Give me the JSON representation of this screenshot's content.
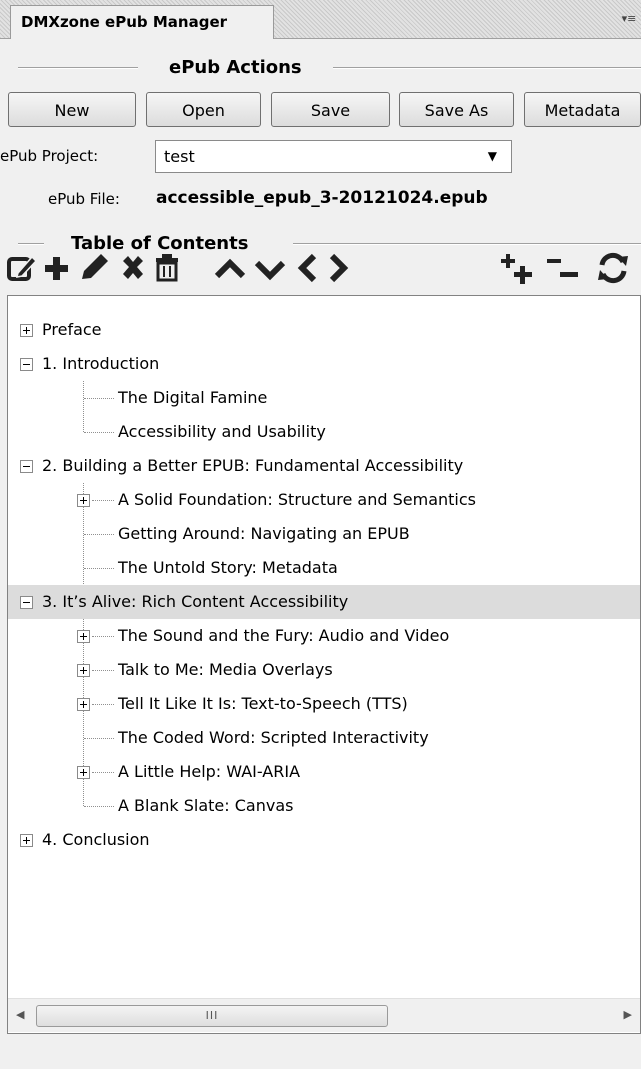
{
  "panel": {
    "tab_title": "DMXzone ePub Manager",
    "menu_icon": "panel-menu-icon"
  },
  "actions": {
    "section_title": "ePub Actions",
    "buttons": [
      "New",
      "Open",
      "Save",
      "Save As",
      "Metadata"
    ]
  },
  "project": {
    "label": "ePub Project:",
    "value": "test",
    "file_label": "ePub File:",
    "file_value": "accessible_epub_3-20121024.epub"
  },
  "toc": {
    "section_title": "Table of Contents",
    "toolbar_icons": [
      "edit-icon",
      "add-icon",
      "rename-icon",
      "remove-icon",
      "delete-icon",
      "move-up-icon",
      "move-down-icon",
      "outdent-icon",
      "indent-icon",
      "expand-all-icon",
      "collapse-all-icon",
      "refresh-icon"
    ],
    "nodes": [
      {
        "label": "Preface",
        "level": 0,
        "state": "collapsed"
      },
      {
        "label": "1. Introduction",
        "level": 0,
        "state": "expanded"
      },
      {
        "label": "The Digital Famine",
        "level": 1,
        "state": "leaf"
      },
      {
        "label": "Accessibility and Usability",
        "level": 1,
        "state": "leaf"
      },
      {
        "label": "2. Building a Better EPUB: Fundamental Accessibility",
        "level": 0,
        "state": "expanded"
      },
      {
        "label": "A Solid Foundation: Structure and Semantics",
        "level": 1,
        "state": "collapsed"
      },
      {
        "label": "Getting Around: Navigating an EPUB",
        "level": 1,
        "state": "leaf"
      },
      {
        "label": "The Untold Story: Metadata",
        "level": 1,
        "state": "leaf"
      },
      {
        "label": "3. It’s Alive: Rich Content Accessibility",
        "level": 0,
        "state": "expanded",
        "selected": true
      },
      {
        "label": "The Sound and the Fury: Audio and Video",
        "level": 1,
        "state": "collapsed"
      },
      {
        "label": "Talk to Me: Media Overlays",
        "level": 1,
        "state": "collapsed"
      },
      {
        "label": "Tell It Like It Is: Text-to-Speech (TTS)",
        "level": 1,
        "state": "collapsed"
      },
      {
        "label": "The Coded Word: Scripted Interactivity",
        "level": 1,
        "state": "leaf"
      },
      {
        "label": "A Little Help: WAI-ARIA",
        "level": 1,
        "state": "collapsed"
      },
      {
        "label": "A Blank Slate: Canvas",
        "level": 1,
        "state": "leaf"
      },
      {
        "label": "4. Conclusion",
        "level": 0,
        "state": "collapsed"
      }
    ]
  },
  "scrollbar": {
    "thumb_grip": "III"
  }
}
